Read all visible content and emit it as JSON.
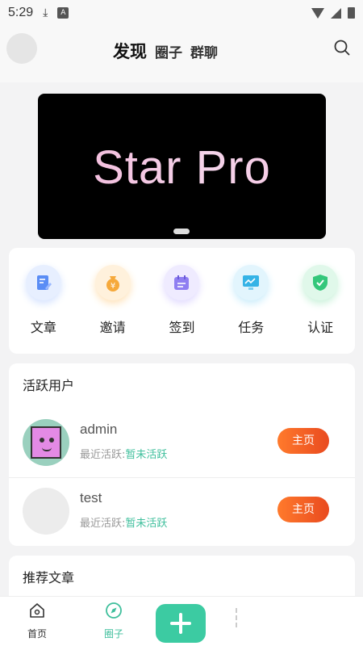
{
  "status_bar": {
    "time": "5:29",
    "download_icon": "download-icon",
    "app_icon_letter": "A"
  },
  "header": {
    "tabs": [
      {
        "label": "发现",
        "active": true
      },
      {
        "label": "圈子",
        "active": false
      },
      {
        "label": "群聊",
        "active": false
      }
    ],
    "search_icon": "search-icon"
  },
  "banner": {
    "text": "Star Pro"
  },
  "features": [
    {
      "label": "文章",
      "icon": "article-icon",
      "color": "#5a8df5"
    },
    {
      "label": "邀请",
      "icon": "invite-money-bag-icon",
      "color": "#f6a93b"
    },
    {
      "label": "签到",
      "icon": "checkin-calendar-icon",
      "color": "#8f7ef1"
    },
    {
      "label": "任务",
      "icon": "task-monitor-icon",
      "color": "#35b3e6"
    },
    {
      "label": "认证",
      "icon": "verify-shield-icon",
      "color": "#34c77b"
    }
  ],
  "active_users": {
    "title": "活跃用户",
    "users": [
      {
        "name": "admin",
        "last_active_label": "最近活跃:",
        "last_active_value": "暂未活跃",
        "button": "主页"
      },
      {
        "name": "test",
        "last_active_label": "最近活跃:",
        "last_active_value": "暂未活跃",
        "button": "主页"
      }
    ]
  },
  "recommended": {
    "title": "推荐文章"
  },
  "bottom_nav": {
    "items": [
      {
        "label": "首页",
        "icon": "home-icon"
      },
      {
        "label": "圈子",
        "icon": "compass-icon",
        "active": true
      }
    ],
    "add_icon": "plus-icon",
    "accent": "#3fbf9c"
  }
}
